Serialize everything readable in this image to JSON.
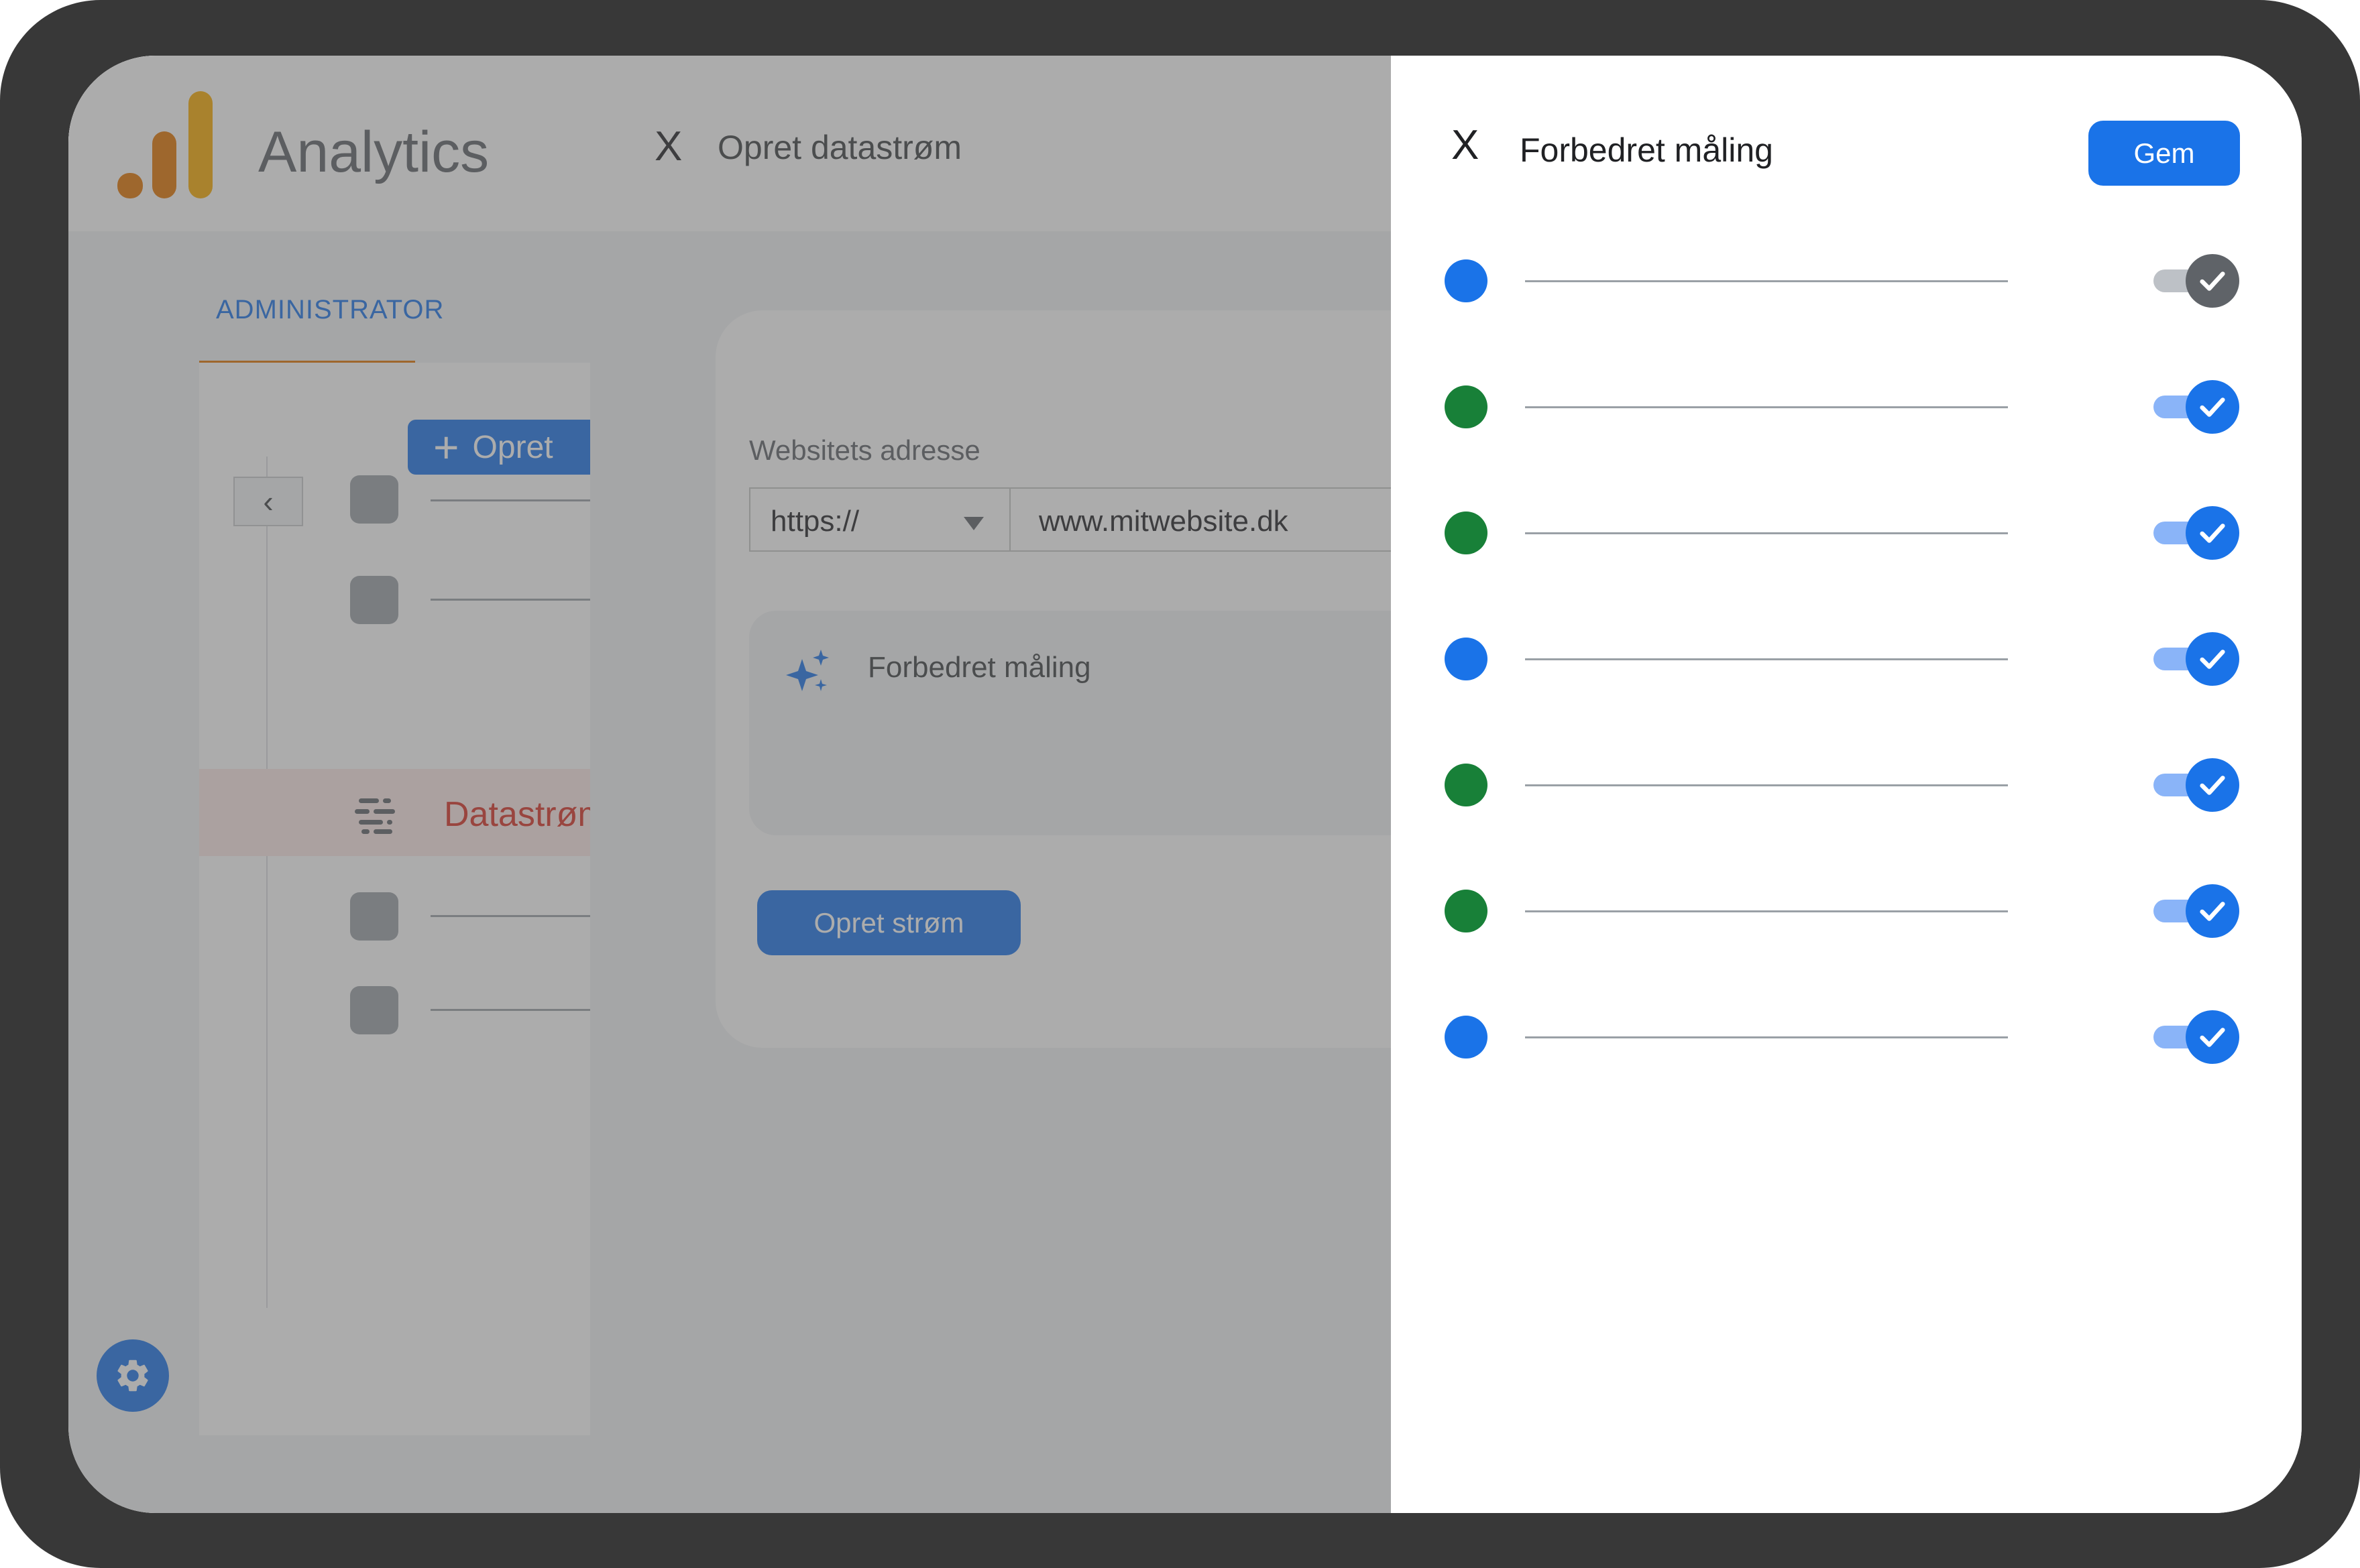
{
  "app": {
    "brand": "Analytics"
  },
  "subpage": {
    "close_glyph": "X",
    "title": "Opret datastrøm"
  },
  "admin": {
    "tab_label": "ADMINISTRATOR",
    "create_label": "Opret",
    "collapse_glyph": "‹",
    "active_item_label": "Datastrøm"
  },
  "form": {
    "field_label": "Websitets adresse",
    "protocol_value": "https://",
    "url_value": "www.mitwebsite.dk",
    "enhanced_label": "Forbedret måling",
    "create_stream_label": "Opret strøm"
  },
  "drawer": {
    "close_glyph": "X",
    "title": "Forbedret måling",
    "save_label": "Gem",
    "rows": [
      {
        "dot_color": "#1a73e8",
        "enabled": true,
        "style": "gray"
      },
      {
        "dot_color": "#188038",
        "enabled": true,
        "style": "blue"
      },
      {
        "dot_color": "#188038",
        "enabled": true,
        "style": "blue"
      },
      {
        "dot_color": "#1a73e8",
        "enabled": true,
        "style": "blue"
      },
      {
        "dot_color": "#188038",
        "enabled": true,
        "style": "blue"
      },
      {
        "dot_color": "#188038",
        "enabled": true,
        "style": "blue"
      },
      {
        "dot_color": "#1a73e8",
        "enabled": true,
        "style": "blue"
      }
    ]
  },
  "colors": {
    "accent": "#1a73e8",
    "green": "#188038",
    "active_nav_text": "#d93025",
    "brand_orange": "#e37400",
    "brand_yellow": "#f9ab00"
  },
  "icons": [
    "analytics-logo-icon",
    "close-icon",
    "plus-icon",
    "chevron-left-icon",
    "data-stream-icon",
    "sparkle-icon",
    "dropdown-arrow-icon",
    "gear-icon",
    "checkmark-icon"
  ]
}
